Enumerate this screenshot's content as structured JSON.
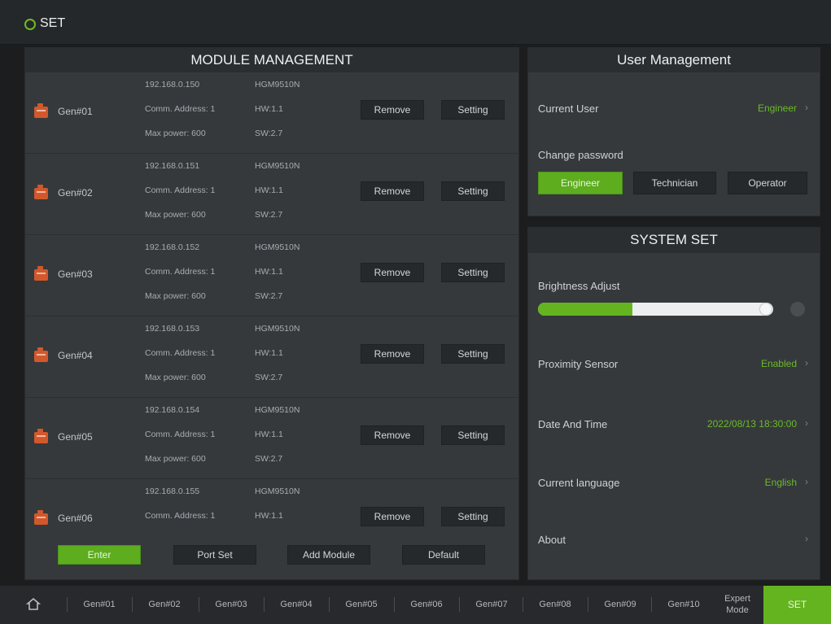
{
  "window": {
    "title": "SET"
  },
  "module_panel": {
    "title": "MODULE MANAGEMENT",
    "modules": [
      {
        "name": "Gen#01",
        "ip": "192.168.0.150",
        "comm": "Comm. Address: 1",
        "power": "Max power: 600",
        "model": "HGM9510N",
        "hw": "HW:1.1",
        "sw": "SW:2.7"
      },
      {
        "name": "Gen#02",
        "ip": "192.168.0.151",
        "comm": "Comm. Address: 1",
        "power": "Max power: 600",
        "model": "HGM9510N",
        "hw": "HW:1.1",
        "sw": "SW:2.7"
      },
      {
        "name": "Gen#03",
        "ip": "192.168.0.152",
        "comm": "Comm. Address: 1",
        "power": "Max power: 600",
        "model": "HGM9510N",
        "hw": "HW:1.1",
        "sw": "SW:2.7"
      },
      {
        "name": "Gen#04",
        "ip": "192.168.0.153",
        "comm": "Comm. Address: 1",
        "power": "Max power: 600",
        "model": "HGM9510N",
        "hw": "HW:1.1",
        "sw": "SW:2.7"
      },
      {
        "name": "Gen#05",
        "ip": "192.168.0.154",
        "comm": "Comm. Address: 1",
        "power": "Max power: 600",
        "model": "HGM9510N",
        "hw": "HW:1.1",
        "sw": "SW:2.7"
      },
      {
        "name": "Gen#06",
        "ip": "192.168.0.155",
        "comm": "Comm. Address: 1",
        "power": "",
        "model": "HGM9510N",
        "hw": "HW:1.1",
        "sw": ""
      }
    ],
    "remove_label": "Remove",
    "setting_label": "Setting",
    "footer": {
      "enter": "Enter",
      "port_set": "Port Set",
      "add_module": "Add Module",
      "default": "Default"
    }
  },
  "user_panel": {
    "title": "User Management",
    "current_user_label": "Current User",
    "current_user_value": "Engineer",
    "change_password_label": "Change password",
    "roles": [
      "Engineer",
      "Technician",
      "Operator"
    ]
  },
  "system_panel": {
    "title": "SYSTEM SET",
    "brightness_label": "Brightness Adjust",
    "brightness_level": 0.4,
    "proximity_label": "Proximity Sensor",
    "proximity_value": "Enabled",
    "datetime_label": "Date And Time",
    "datetime_value": "2022/08/13 18:30:00",
    "language_label": "Current language",
    "language_value": "English",
    "about_label": "About",
    "arrow": "›"
  },
  "bottom_nav": {
    "tabs": [
      "Gen#01",
      "Gen#02",
      "Gen#03",
      "Gen#04",
      "Gen#05",
      "Gen#06",
      "Gen#07",
      "Gen#08",
      "Gen#09",
      "Gen#10"
    ],
    "expert_mode": "Expert Mode",
    "set_label": "SET"
  },
  "colors": {
    "accent": "#64b41f",
    "panel": "#35393c",
    "header": "#2b2e31",
    "background": "#1b1d1f"
  },
  "icons": {
    "title": "settings-circle-icon",
    "home": "home-icon",
    "generator": "generator-icon",
    "brightness": "brightness-icon"
  }
}
